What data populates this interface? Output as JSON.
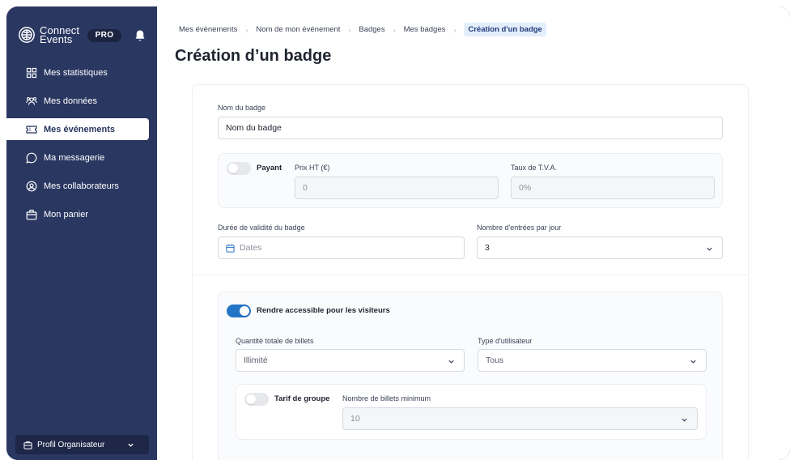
{
  "brand": {
    "name_line1": "Connect",
    "name_line2": "Events",
    "plan_badge": "PRO"
  },
  "sidebar": {
    "items": [
      {
        "label": "Mes statistiques",
        "icon": "grid-icon",
        "active": false
      },
      {
        "label": "Mes données",
        "icon": "users-icon",
        "active": false
      },
      {
        "label": "Mes événements",
        "icon": "ticket-icon",
        "active": true
      },
      {
        "label": "Ma messagerie",
        "icon": "chat-icon",
        "active": false
      },
      {
        "label": "Mes collaborateurs",
        "icon": "at-icon",
        "active": false
      },
      {
        "label": "Mon panier",
        "icon": "bag-icon",
        "active": false
      }
    ],
    "profile_label": "Profil Organisateur"
  },
  "breadcrumb": [
    "Mes événements",
    "Nom de mon événement",
    "Badges",
    "Mes badges",
    "Création d'un badge"
  ],
  "page_title": "Création d’un badge",
  "form": {
    "badge_name": {
      "label": "Nom du badge",
      "value": "Nom du badge"
    },
    "paid": {
      "toggle_label": "Payant",
      "enabled": false
    },
    "price": {
      "label": "Prix HT (€)",
      "value": "0"
    },
    "vat": {
      "label": "Taux de T.V.A.",
      "value": "0%"
    },
    "validity": {
      "label": "Durée de validité du badge",
      "placeholder": "Dates"
    },
    "entries_per_day": {
      "label": "Nombre d'entrées par jour",
      "value": "3"
    },
    "visitor_access": {
      "toggle_label": "Rendre accessible pour les visiteurs",
      "enabled": true
    },
    "total_quantity": {
      "label": "Quantité totale de billets",
      "value": "Illimité"
    },
    "user_type": {
      "label": "Type d'utilisateur",
      "value": "Tous"
    },
    "group_rate": {
      "toggle_label": "Tarif de groupe",
      "enabled": false
    },
    "min_tickets": {
      "label": "Nombre de billets minimum",
      "value": "10"
    }
  },
  "colors": {
    "sidebar_bg": "#2a3761",
    "accent": "#2474c6",
    "frame": "#1c2135"
  }
}
